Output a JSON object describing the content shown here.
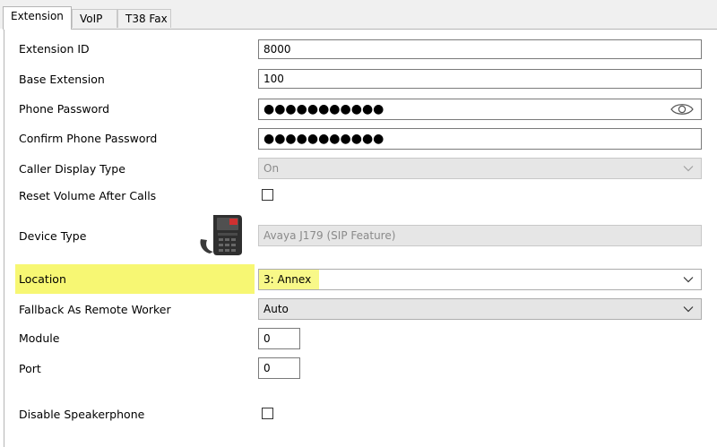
{
  "tabs": [
    {
      "label": "Extension",
      "active": true
    },
    {
      "label": "VoIP",
      "active": false
    },
    {
      "label": "T38 Fax",
      "active": false
    }
  ],
  "form": {
    "extension_id": {
      "label": "Extension ID",
      "value": "8000"
    },
    "base_extension": {
      "label": "Base Extension",
      "value": "100"
    },
    "phone_password": {
      "label": "Phone Password",
      "value": "●●●●●●●●●●●"
    },
    "confirm_phone_password": {
      "label": "Confirm Phone Password",
      "value": "●●●●●●●●●●●"
    },
    "caller_display_type": {
      "label": "Caller Display Type",
      "value": "On"
    },
    "reset_volume": {
      "label": "Reset Volume After Calls",
      "checked": false
    },
    "device_type": {
      "label": "Device Type",
      "value": "Avaya J179 (SIP Feature)"
    },
    "location": {
      "label": "Location",
      "value": "3: Annex"
    },
    "fallback_remote_worker": {
      "label": "Fallback As Remote Worker",
      "value": "Auto"
    },
    "module": {
      "label": "Module",
      "value": "0"
    },
    "port": {
      "label": "Port",
      "value": "0"
    },
    "disable_speakerphone": {
      "label": "Disable Speakerphone",
      "checked": false
    }
  },
  "colors": {
    "highlight": "#f7f773",
    "tab_bg": "#f0f0f0",
    "field_border": "#7a7a7a",
    "disabled_bg": "#e6e6e6"
  },
  "icons": {
    "password_reveal": "eye-icon",
    "device": "desk-phone-icon",
    "dropdown": "chevron-down-icon"
  }
}
